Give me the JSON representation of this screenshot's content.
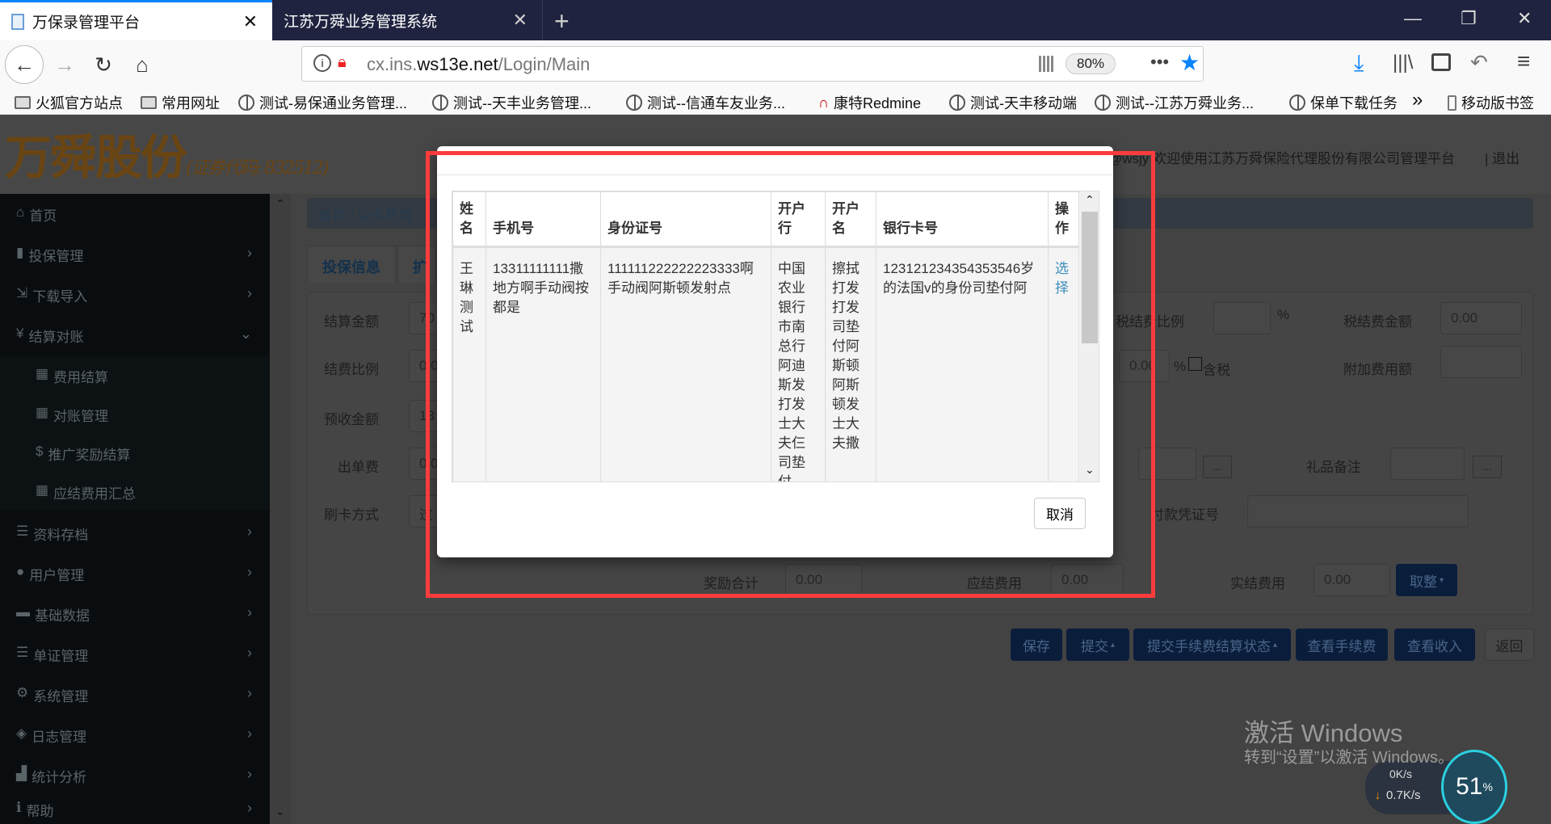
{
  "browser": {
    "tabs": [
      {
        "title": "万保录管理平台",
        "active": true
      },
      {
        "title": "江苏万舜业务管理系统",
        "active": false
      }
    ],
    "new_tab": "+",
    "url_host": "cx.ins.",
    "url_domain": "ws13e.net",
    "url_path": "/Login/Main",
    "zoom": "80%",
    "bookmarks": [
      "火狐官方站点",
      "常用网址",
      "测试-易保通业务管理...",
      "测试--天丰业务管理...",
      "测试--信通车友业务...",
      "康特Redmine",
      "测试-天丰移动端",
      "测试--江苏万舜业务...",
      "保单下载任务",
      "移动版书签"
    ],
    "overflow": "»",
    "accent": "#0a84ff"
  },
  "app": {
    "logo": "万舜股份",
    "logo_sub": "(证券代码: 832512)",
    "welcome": "@wsjy  欢迎使用江苏万舜保险代理股份有限公司管理平台",
    "logout": "| 退出",
    "sidebar": [
      {
        "label": "首页",
        "icon": "home-icon"
      },
      {
        "label": "投保管理",
        "icon": "file-icon"
      },
      {
        "label": "下载导入",
        "icon": "import-icon"
      },
      {
        "label": "结算对账",
        "icon": "yen-icon",
        "expanded": true
      },
      {
        "label": "费用结算",
        "icon": "grid-icon"
      },
      {
        "label": "对账管理",
        "icon": "grid-icon"
      },
      {
        "label": "推广奖励结算",
        "icon": "dollar-icon"
      },
      {
        "label": "应结费用汇总",
        "icon": "grid-icon"
      },
      {
        "label": "资料存档",
        "icon": "list-icon"
      },
      {
        "label": "用户管理",
        "icon": "user-icon"
      },
      {
        "label": "基础数据",
        "icon": "drive-icon"
      },
      {
        "label": "单证管理",
        "icon": "list-icon"
      },
      {
        "label": "系统管理",
        "icon": "gear-icon"
      },
      {
        "label": "日志管理",
        "icon": "tags-icon"
      },
      {
        "label": "统计分析",
        "icon": "chart-icon"
      },
      {
        "label": "帮助",
        "icon": "info-icon"
      }
    ],
    "breadcrumb": [
      "首页",
      "业务费用"
    ],
    "tabs": [
      "投保信息",
      "扩"
    ],
    "form": {
      "settle_amount": {
        "label": "结算金额",
        "value": "70"
      },
      "fee_ratio": {
        "label": "结费比例",
        "value": "0.0"
      },
      "prepaid": {
        "label": "预收金额",
        "value": "13"
      },
      "issue_fee": {
        "label": "出单费",
        "value": "0.0"
      },
      "card_mode": {
        "label": "刷卡方式",
        "value": "过"
      },
      "tax_ratio": {
        "label": "税结费比例",
        "value": "",
        "unit": "%"
      },
      "tax_amount": {
        "label": "税结费金额",
        "value": "0.00"
      },
      "ratio2": {
        "value": "0.00",
        "unit": "%",
        "checkbox_label": "含税"
      },
      "extra_fee": {
        "label": "附加费用额",
        "value": ""
      },
      "gift_note": {
        "label": "礼品备注",
        "value": ""
      },
      "voucher": {
        "label": "付款凭证号",
        "value": ""
      },
      "reward_total": {
        "label": "奖励合计",
        "value": "0.00"
      },
      "due_fee": {
        "label": "应结费用",
        "value": "0.00"
      },
      "actual_fee": {
        "label": "实结费用",
        "value": "0.00"
      },
      "round_btn": "取整",
      "dots": "..."
    },
    "actions": [
      "保存",
      "提交",
      "提交手续费结算状态",
      "查看手续费",
      "查看收入",
      "返回"
    ]
  },
  "modal": {
    "columns": [
      "姓名",
      "手机号",
      "身份证号",
      "开户行",
      "开户名",
      "银行卡号",
      "操作"
    ],
    "rows": [
      {
        "name": "王琳测试",
        "phone": "13311111111撒地方啊手动阀按都是",
        "id_no": "111111222222223333啊手动阀阿斯顿发射点",
        "bank": "中国农业银行市南总行阿迪斯发打发士大夫仨司垫付",
        "account_name": "擦拭打发打发司垫付阿斯顿阿斯顿发士大夫撒",
        "card_no": "123121234354353546岁的法国v的身份司垫付阿",
        "action": "选择"
      }
    ],
    "cancel": "取消",
    "highlight_color": "#ff3b3b"
  },
  "system": {
    "activate_title": "激活 Windows",
    "activate_sub": "转到“设置”以激活 Windows。",
    "net_up": "0K/s",
    "net_down": "0.7K/s",
    "cpu": "51",
    "cpu_unit": "%"
  }
}
